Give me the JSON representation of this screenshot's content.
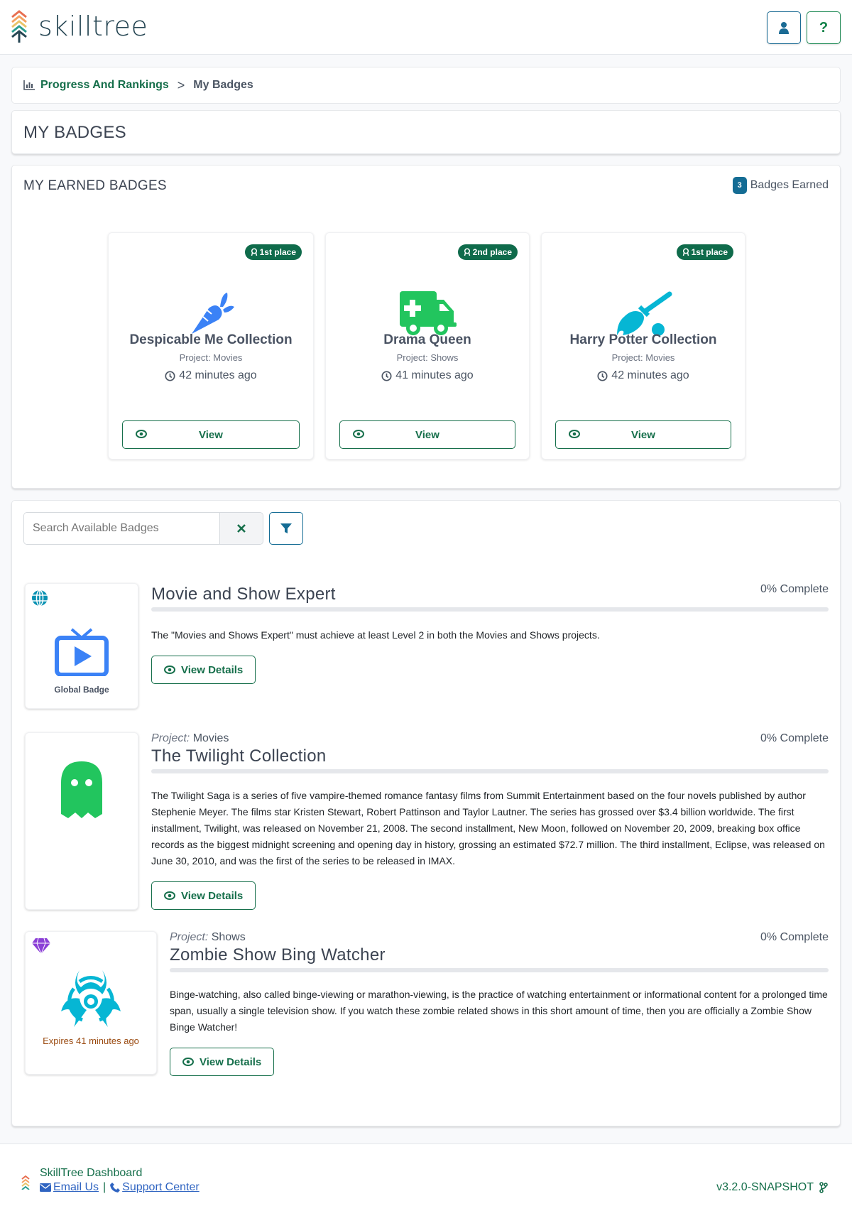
{
  "header": {
    "app_name": "skilltree",
    "user_button_icon": "user-icon",
    "help_button_label": "?"
  },
  "breadcrumb": {
    "icon": "chart-bar-icon",
    "parent": "Progress And Rankings",
    "separator": ">",
    "current": "My Badges"
  },
  "page_title": "MY BADGES",
  "earned": {
    "title": "MY EARNED BADGES",
    "count": "3",
    "count_label": "Badges Earned",
    "badges": [
      {
        "name": "Despicable Me Collection",
        "project": "Project: Movies",
        "time": "42 minutes ago",
        "place": "1st place",
        "icon": "carrot-icon",
        "icon_color": "#3b82f6",
        "view_label": "View"
      },
      {
        "name": "Drama Queen",
        "project": "Project: Shows",
        "time": "41 minutes ago",
        "place": "2nd place",
        "icon": "ambulance-icon",
        "icon_color": "#22c55e",
        "view_label": "View"
      },
      {
        "name": "Harry Potter Collection",
        "project": "Project: Movies",
        "time": "42 minutes ago",
        "place": "1st place",
        "icon": "broom-icon",
        "icon_color": "#06b6d4",
        "view_label": "View"
      }
    ]
  },
  "available": {
    "search_placeholder": "Search Available Badges",
    "search_value": "",
    "clear_icon": "x-icon",
    "filter_icon": "filter-icon",
    "badges": [
      {
        "name": "Movie and Show Expert",
        "project_label": "",
        "project": "",
        "percent_complete": 0,
        "complete_label": "0% Complete",
        "description": "The \"Movies and Shows Expert\" must achieve at least Level 2 in both the Movies and Shows projects.",
        "caption": "Global Badge",
        "corner_icon": "globe-icon",
        "icon": "tv-icon",
        "icon_color": "#3b82f6",
        "details_label": "View Details"
      },
      {
        "name": "The Twilight Collection",
        "project_label": "Project:",
        "project": "Movies",
        "percent_complete": 0,
        "complete_label": "0% Complete",
        "description": "The Twilight Saga is a series of five vampire-themed romance fantasy films from Summit Entertainment based on the four novels published by author Stephenie Meyer. The films star Kristen Stewart, Robert Pattinson and Taylor Lautner. The series has grossed over $3.4 billion worldwide. The first installment, Twilight, was released on November 21, 2008. The second installment, New Moon, followed on November 20, 2009, breaking box office records as the biggest midnight screening and opening day in history, grossing an estimated $72.7 million. The third installment, Eclipse, was released on June 30, 2010, and was the first of the series to be released in IMAX.",
        "caption": "",
        "icon": "ghost-icon",
        "icon_color": "#22c55e",
        "details_label": "View Details"
      },
      {
        "name": "Zombie Show Bing Watcher",
        "project_label": "Project:",
        "project": "Shows",
        "percent_complete": 0,
        "complete_label": "0% Complete",
        "description": "Binge-watching, also called binge-viewing or marathon-viewing, is the practice of watching entertainment or informational content for a prolonged time span, usually a single television show. If you watch these zombie related shows in this short amount of time, then you are officially a Zombie Show Binge Watcher!",
        "caption": "Expires 41 minutes ago",
        "corner_icon": "gem-icon",
        "icon": "biohazard-icon",
        "icon_color": "#06b6d4",
        "details_label": "View Details"
      }
    ]
  },
  "footer": {
    "title": "SkillTree Dashboard",
    "email_label": "Email Us",
    "separator": "|",
    "support_label": "Support Center",
    "version": "v3.2.0-SNAPSHOT"
  },
  "colors": {
    "primary_green": "#166f4b",
    "primary_blue": "#146c94",
    "expire_text": "#9a4a10",
    "gem": "#8b3fd6"
  }
}
